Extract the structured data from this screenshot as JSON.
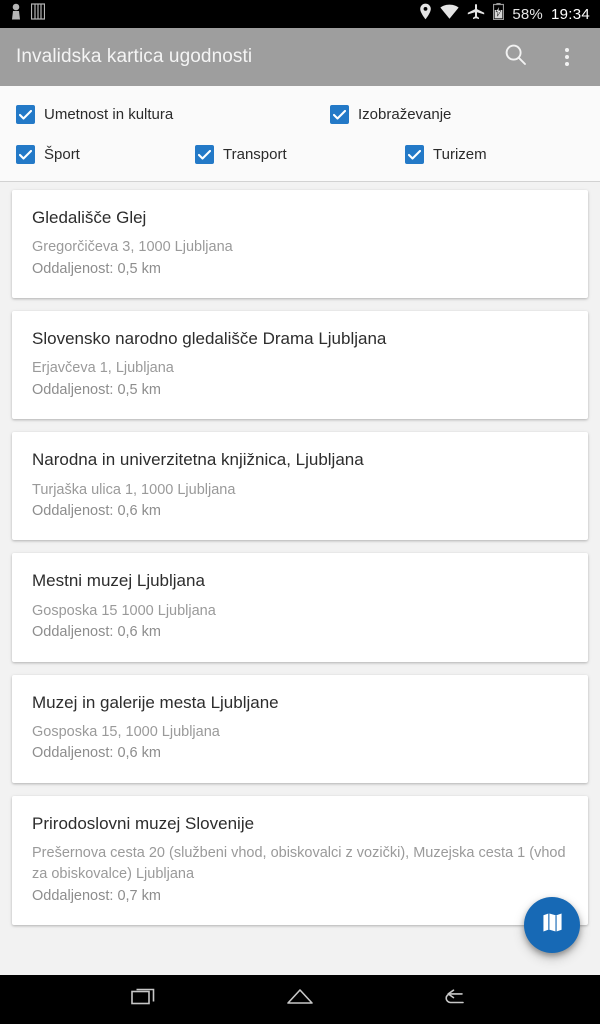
{
  "statusbar": {
    "left_icons": [
      "person-icon",
      "sim-card-icon"
    ],
    "right_icons": [
      "location-pin-icon",
      "wifi-icon",
      "airplane-mode-icon",
      "battery-charging-icon"
    ],
    "battery_text": "58%",
    "time": "19:34"
  },
  "appbar": {
    "title": "Invalidska kartica ugodnosti",
    "search_icon": "search-icon",
    "overflow_icon": "more-vertical-icon",
    "background_color": "#9e9e9e"
  },
  "filters": {
    "accent_color": "#2379c7",
    "items": [
      {
        "label": "Umetnost in kultura",
        "checked": true
      },
      {
        "label": "Izobraževanje",
        "checked": true
      },
      {
        "label": "Šport",
        "checked": true
      },
      {
        "label": "Transport",
        "checked": true
      },
      {
        "label": "Turizem",
        "checked": true
      }
    ]
  },
  "list": {
    "cards": [
      {
        "title": "Gledališče Glej",
        "address": "Gregorčičeva 3, 1000 Ljubljana",
        "distance": "Oddaljenost: 0,5 km"
      },
      {
        "title": "Slovensko narodno gledališče Drama Ljubljana",
        "address": "Erjavčeva 1, Ljubljana",
        "distance": "Oddaljenost: 0,5 km"
      },
      {
        "title": "Narodna in univerzitetna knjižnica, Ljubljana",
        "address": "Turjaška ulica 1, 1000 Ljubljana",
        "distance": "Oddaljenost: 0,6 km"
      },
      {
        "title": "Mestni muzej Ljubljana",
        "address": "Gosposka 15 1000 Ljubljana",
        "distance": "Oddaljenost: 0,6 km"
      },
      {
        "title": "Muzej in galerije mesta Ljubljane",
        "address": "Gosposka 15, 1000 Ljubljana",
        "distance": "Oddaljenost: 0,6 km"
      },
      {
        "title": "Prirodoslovni muzej Slovenije",
        "address": "Prešernova cesta 20 (službeni vhod, obiskovalci z vozički), Muzejska cesta 1 (vhod za obiskovalce) Ljubljana",
        "distance": "Oddaljenost: 0,7 km"
      }
    ]
  },
  "fab": {
    "icon": "map-icon",
    "color": "#1769b5"
  },
  "navbar": {
    "recents_icon": "recents-icon",
    "home_icon": "home-icon",
    "back_icon": "back-icon"
  }
}
